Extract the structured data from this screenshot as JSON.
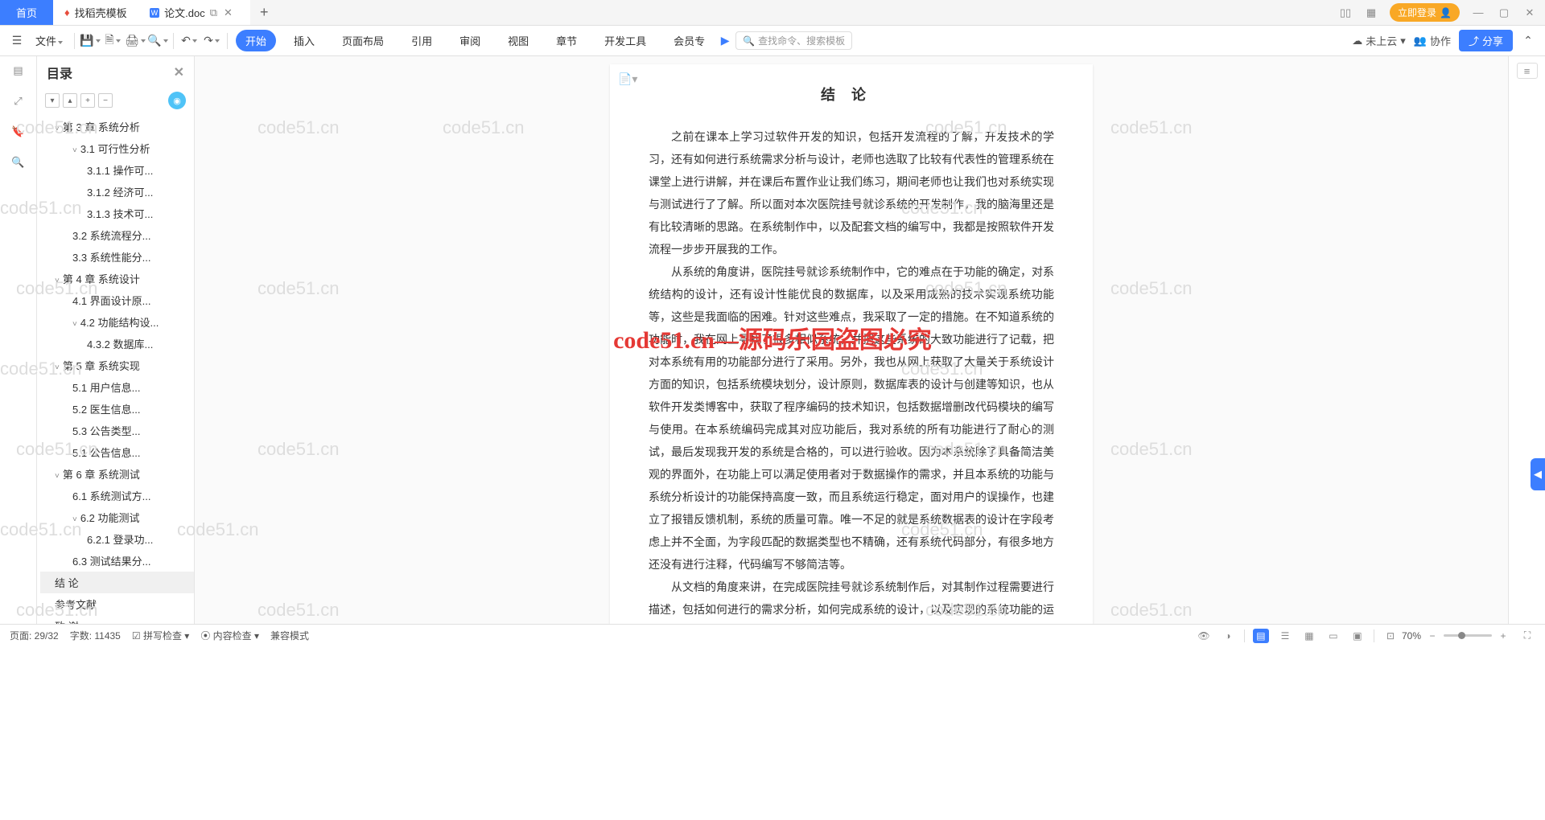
{
  "tabs": {
    "home": "首页",
    "template": "找稻壳模板",
    "doc": "论文.doc"
  },
  "actions": {
    "login": "立即登录"
  },
  "ribbon": {
    "file": "文件",
    "tabs": [
      "开始",
      "插入",
      "页面布局",
      "引用",
      "审阅",
      "视图",
      "章节",
      "开发工具",
      "会员专"
    ],
    "search_ph": "查找命令、搜索模板",
    "cloud": "未上云",
    "collab": "协作",
    "share": "分享"
  },
  "outline": {
    "title": "目录",
    "items": [
      {
        "lvl": 1,
        "label": "第 3 章 系统分析",
        "arrow": true
      },
      {
        "lvl": 2,
        "label": "3.1 可行性分析",
        "arrow": true
      },
      {
        "lvl": 3,
        "label": "3.1.1 操作可..."
      },
      {
        "lvl": 3,
        "label": "3.1.2 经济可..."
      },
      {
        "lvl": 3,
        "label": "3.1.3 技术可..."
      },
      {
        "lvl": 2,
        "label": "3.2 系统流程分..."
      },
      {
        "lvl": 2,
        "label": "3.3 系统性能分..."
      },
      {
        "lvl": 1,
        "label": "第 4 章  系统设计",
        "arrow": true
      },
      {
        "lvl": 2,
        "label": "4.1 界面设计原..."
      },
      {
        "lvl": 2,
        "label": "4.2 功能结构设...",
        "arrow": true
      },
      {
        "lvl": 3,
        "label": "4.3.2  数据库..."
      },
      {
        "lvl": 1,
        "label": "第 5 章  系统实现",
        "arrow": true
      },
      {
        "lvl": 2,
        "label": "5.1 用户信息..."
      },
      {
        "lvl": 2,
        "label": "5.2 医生信息..."
      },
      {
        "lvl": 2,
        "label": "5.3 公告类型..."
      },
      {
        "lvl": 2,
        "label": "5.1 公告信息..."
      },
      {
        "lvl": 1,
        "label": "第 6 章  系统测试",
        "arrow": true
      },
      {
        "lvl": 2,
        "label": "6.1 系统测试方..."
      },
      {
        "lvl": 2,
        "label": "6.2 功能测试",
        "arrow": true
      },
      {
        "lvl": 3,
        "label": "6.2.1 登录功..."
      },
      {
        "lvl": 2,
        "label": "6.3 测试结果分..."
      },
      {
        "lvl": 1,
        "label": "结  论",
        "active": true
      },
      {
        "lvl": 1,
        "label": "参考文献"
      },
      {
        "lvl": 1,
        "label": "致  谢"
      }
    ]
  },
  "doc": {
    "heading": "结论",
    "p1": "之前在课本上学习过软件开发的知识，包括开发流程的了解，开发技术的学习，还有如何进行系统需求分析与设计，老师也选取了比较有代表性的管理系统在课堂上进行讲解，并在课后布置作业让我们练习，期间老师也让我们也对系统实现与测试进行了了解。所以面对本次医院挂号就诊系统的开发制作，我的脑海里还是有比较清晰的思路。在系统制作中，以及配套文档的编写中，我都是按照软件开发流程一步步开展我的工作。",
    "p2": "从系统的角度讲，医院挂号就诊系统制作中，它的难点在于功能的确定，对系统结构的设计，还有设计性能优良的数据库，以及采用成熟的技术实现系统功能等，这些是我面临的困难。针对这些难点，我采取了一定的措施。在不知道系统的功能时，我在网上寻找了很多相似系统，并把这些系统的大致功能进行了记载，把对本系统有用的功能部分进行了采用。另外，我也从网上获取了大量关于系统设计方面的知识，包括系统模块划分，设计原则，数据库表的设计与创建等知识，也从软件开发类博客中，获取了程序编码的技术知识，包括数据增删改代码模块的编写与使用。在本系统编码完成其对应功能后，我对系统的所有功能进行了耐心的测试，最后发现我开发的系统是合格的，可以进行验收。因为本系统除了具备简洁美观的界面外，在功能上可以满足使用者对于数据操作的需求，并且本系统的功能与系统分析设计的功能保持高度一致，而且系统运行稳定，面对用户的误操作，也建立了报错反馈机制，系统的质量可靠。唯一不足的就是系统数据表的设计在字段考虑上并不全面，为字段匹配的数据类型也不精确，还有系统代码部分，有很多地方还没有进行注释，代码编写不够简洁等。",
    "p3": "从文档的角度来讲，在完成医院挂号就诊系统制作后，对其制作过程需要进行描述，包括如何进行的需求分析，如何完成系统的设计，以及实现的系统功能的运行效果等都要进行描述。这期间我也花费了将近一个月时间来完成，为了达到学院要求的文档排版标准，我也多次在导师建议下，学习办公软件的使用，还"
  },
  "status": {
    "page": "页面: 29/32",
    "words": "字数: 11435",
    "spell": "拼写检查",
    "content": "内容检查",
    "compat": "兼容模式",
    "zoom": "70%"
  },
  "wm": {
    "site": "code51.cn",
    "center": "code51.cn—源码乐园盗图必究"
  }
}
